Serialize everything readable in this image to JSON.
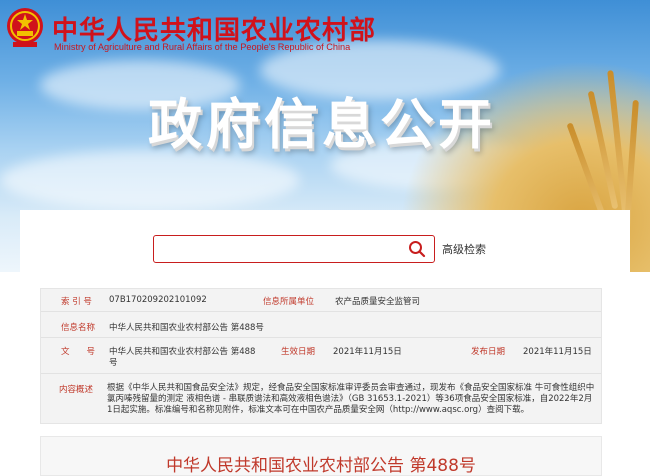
{
  "header": {
    "title": "中华人民共和国农业农村部",
    "subtitle": "Ministry of Agriculture and Rural Affairs of the People's Republic of China",
    "banner_text": "政府信息公开"
  },
  "search": {
    "value": "",
    "advanced_label": "高级检索"
  },
  "info": {
    "index_label": "索 引 号",
    "index_value": "07B170209202101092",
    "owner_label": "信息所属单位",
    "owner_value": "农产品质量安全监管司",
    "name_label": "信息名称",
    "name_value": "中华人民共和国农业农村部公告 第488号",
    "docno_label": "文　　号",
    "docno_value_line1": "中华人民共和国农业农村部公告 第488",
    "docno_value_line2": "号",
    "effective_label": "生效日期",
    "effective_value": "2021年11月15日",
    "publish_label": "发布日期",
    "publish_value": "2021年11月15日",
    "summary_label": "内容概述",
    "summary_value": "根据《中华人民共和国食品安全法》规定，经食品安全国家标准审评委员会审查通过，现发布《食品安全国家标准 牛可食性组织中氯丙嗪残留量的测定 液相色谱 - 串联质谱法和高效液相色谱法》（GB 31653.1-2021）等36项食品安全国家标准，自2022年2月1日起实施。标准编号和名称见附件，标准文本可在中国农产品质量安全网（http://www.aqsc.org）查阅下载。"
  },
  "document": {
    "title": "中华人民共和国农业农村部公告 第488号"
  },
  "colors": {
    "brand_red": "#d0121b",
    "label_red": "#c0392b"
  }
}
